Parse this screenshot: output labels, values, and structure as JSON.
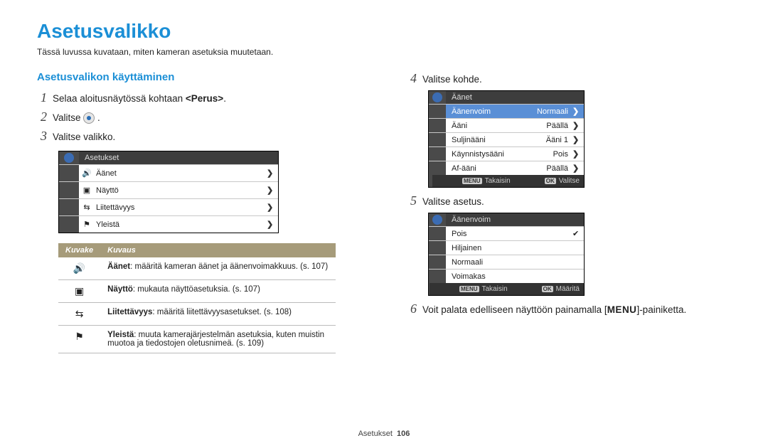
{
  "title": "Asetusvalikko",
  "intro": "Tässä luvussa kuvataan, miten kameran asetuksia muutetaan.",
  "left": {
    "heading": "Asetusvalikon käyttäminen",
    "steps": {
      "s1_pre": "Selaa aloitusnäytössä kohtaan ",
      "s1_bold": "<Perus>",
      "s1_post": ".",
      "s2": "Valitse ",
      "s2_post": ".",
      "s3": "Valitse valikko."
    },
    "menu1": {
      "header": "Asetukset",
      "rows": [
        {
          "label": "Äänet"
        },
        {
          "label": "Näyttö"
        },
        {
          "label": "Liitettävyys"
        },
        {
          "label": "Yleistä"
        }
      ]
    },
    "table": {
      "col1": "Kuvake",
      "col2": "Kuvaus",
      "rows": [
        {
          "bold": "Äänet",
          "text": ": määritä kameran äänet ja äänenvoimakkuus. (s. 107)"
        },
        {
          "bold": "Näyttö",
          "text": ": mukauta näyttöasetuksia. (s. 107)"
        },
        {
          "bold": "Liitettävyys",
          "text": ": määritä liitettävyysasetukset. (s. 108)"
        },
        {
          "bold": "Yleistä",
          "text": ": muuta kamerajärjestelmän asetuksia, kuten muistin muotoa ja tiedostojen oletusnimeä. (s. 109)"
        }
      ]
    }
  },
  "right": {
    "step4": "Valitse kohde.",
    "menu2": {
      "header": "Äänet",
      "rows": [
        {
          "label": "Äänenvoim",
          "value": "Normaali",
          "sel": true
        },
        {
          "label": "Ääni",
          "value": "Päällä"
        },
        {
          "label": "Suljinääni",
          "value": "Ääni 1"
        },
        {
          "label": "Käynnistysääni",
          "value": "Pois"
        },
        {
          "label": "Af-ääni",
          "value": "Päällä"
        }
      ],
      "footer": {
        "back_key": "MENU",
        "back": "Takaisin",
        "ok_key": "OK",
        "ok": "Valitse"
      }
    },
    "step5": "Valitse asetus.",
    "menu3": {
      "header": "Äänenvoim",
      "rows": [
        {
          "label": "Pois",
          "check": true
        },
        {
          "label": "Hiljainen"
        },
        {
          "label": "Normaali"
        },
        {
          "label": "Voimakas"
        }
      ],
      "footer": {
        "back_key": "MENU",
        "back": "Takaisin",
        "ok_key": "OK",
        "ok": "Määritä"
      }
    },
    "step6_pre": "Voit palata edelliseen näyttöön painamalla [",
    "step6_key": "MENU",
    "step6_post": "]-painiketta."
  },
  "footer": {
    "label": "Asetukset",
    "page": "106"
  }
}
